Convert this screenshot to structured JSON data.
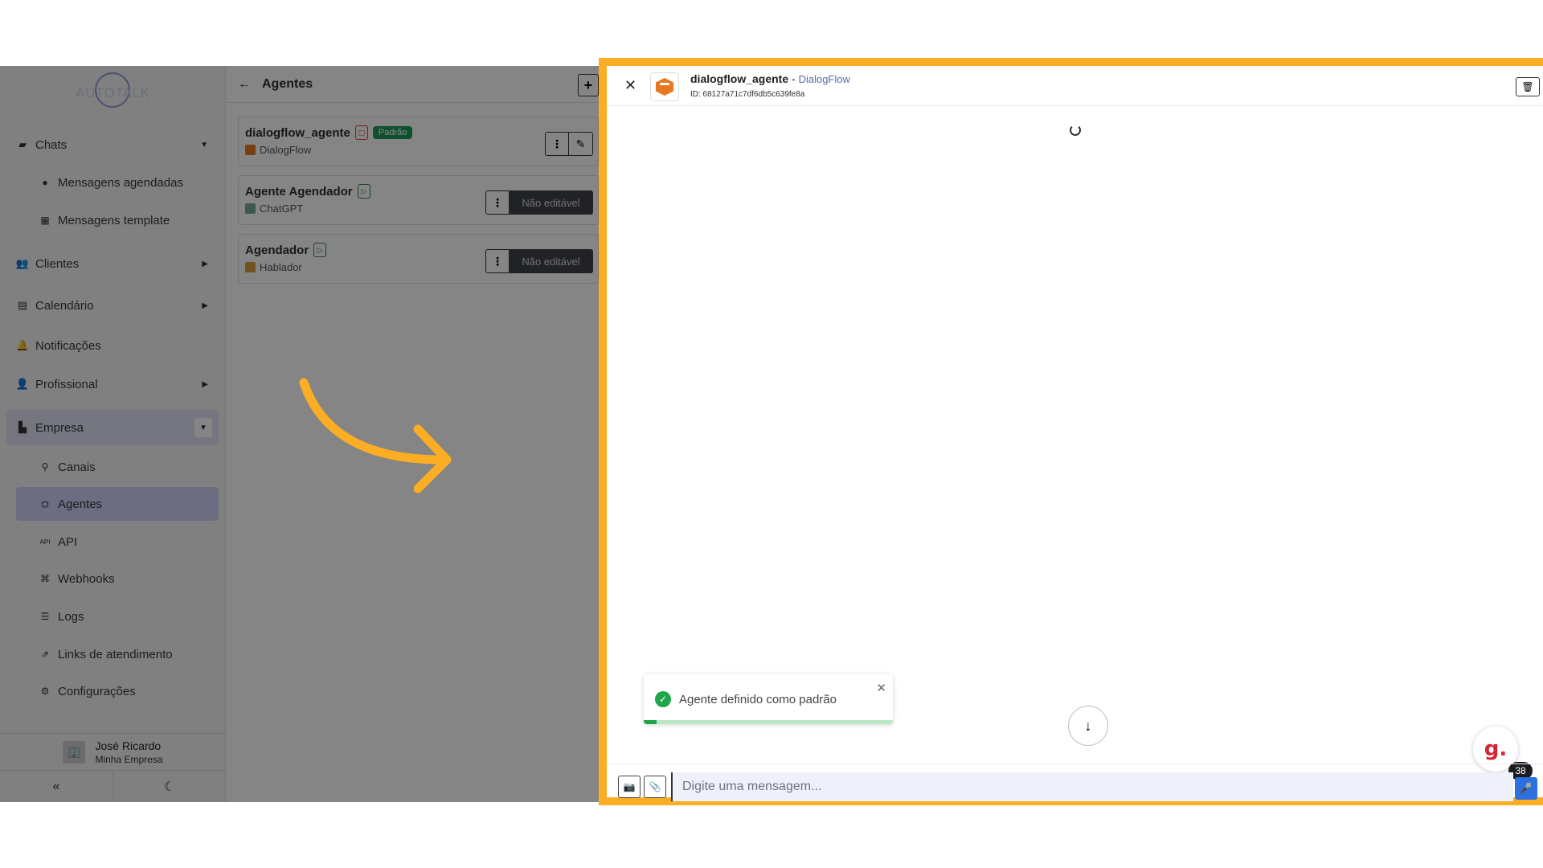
{
  "sidebar": {
    "logo": "AUTOTALK",
    "items": [
      {
        "label": "Chats",
        "icon": "chat-icon"
      },
      {
        "label": "Mensagens agendadas",
        "icon": "clock-icon"
      },
      {
        "label": "Mensagens template",
        "icon": "template-icon"
      },
      {
        "label": "Clientes",
        "icon": "users-icon"
      },
      {
        "label": "Calendário",
        "icon": "calendar-icon"
      },
      {
        "label": "Notificações",
        "icon": "bell-icon"
      },
      {
        "label": "Profissional",
        "icon": "professional-icon"
      },
      {
        "label": "Empresa",
        "icon": "building-icon"
      },
      {
        "label": "Canais",
        "icon": "channel-icon"
      },
      {
        "label": "Agentes",
        "icon": "robot-icon"
      },
      {
        "label": "API",
        "icon": "api-icon"
      },
      {
        "label": "Webhooks",
        "icon": "webhook-icon"
      },
      {
        "label": "Logs",
        "icon": "list-icon"
      },
      {
        "label": "Links de atendimento",
        "icon": "external-link-icon"
      },
      {
        "label": "Configurações",
        "icon": "gear-icon"
      }
    ],
    "user": {
      "name": "José Ricardo",
      "company": "Minha Empresa"
    }
  },
  "agents_panel": {
    "title": "Agentes",
    "agents": [
      {
        "name": "dialogflow_agente",
        "provider": "DialogFlow",
        "badge": "Padrão"
      },
      {
        "name": "Agente Agendador",
        "provider": "ChatGPT",
        "action": "Não editável"
      },
      {
        "name": "Agendador",
        "provider": "Hablador",
        "action": "Não editável"
      }
    ]
  },
  "chat": {
    "agent_name": "dialogflow_agente",
    "separator": " - ",
    "provider": "DialogFlow",
    "id_text": "ID: 68127a71c7df6db5c639fe8a",
    "toast": {
      "message": "Agente definido como padrão",
      "progress": 0.05
    },
    "notification_count": "38",
    "g_logo": "g.",
    "input_placeholder": "Digite uma mensagem..."
  },
  "colors": {
    "highlight_border": "#fbad24",
    "success": "#1fa54a",
    "accent": "#2b6fe0"
  }
}
